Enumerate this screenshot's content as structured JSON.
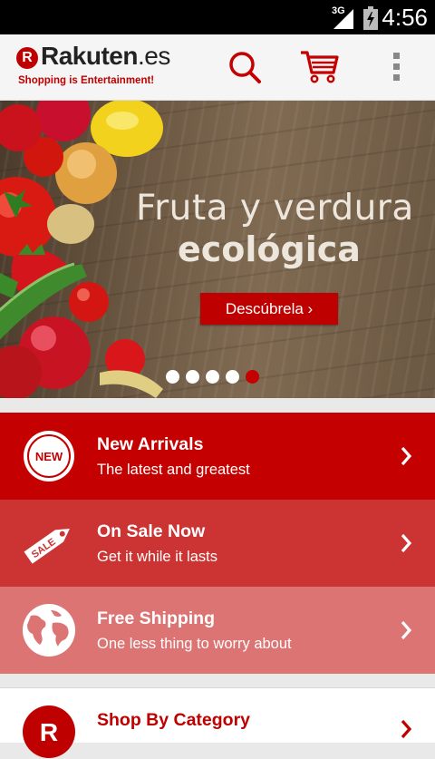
{
  "status_bar": {
    "network": "3G",
    "time": "4:56"
  },
  "app_bar": {
    "logo_mark": "R",
    "brand_name": "Rakuten",
    "brand_tld": ".es",
    "tagline": "Shopping is Entertainment!",
    "icons": [
      "search-icon",
      "cart-icon",
      "overflow-menu-icon"
    ]
  },
  "banner": {
    "title_line1": "Fruta y verdura",
    "title_line2": "ecológica",
    "cta_label": "Descúbrela ›",
    "page_count": 5,
    "active_page": 5
  },
  "promos": [
    {
      "title": "New Arrivals",
      "subtitle": "The latest and greatest",
      "badge": "NEW",
      "icon": "new-badge-icon",
      "color": "#c40000"
    },
    {
      "title": "On Sale Now",
      "subtitle": "Get it while it lasts",
      "badge": "SALE",
      "icon": "sale-tag-icon",
      "color": "#cc3333"
    },
    {
      "title": "Free Shipping",
      "subtitle": "One less thing to worry about",
      "icon": "globe-icon",
      "color": "#dd7474"
    }
  ],
  "category_card": {
    "title": "Shop By Category",
    "logo_mark": "R"
  },
  "colors": {
    "brand_red": "#bf0000",
    "background": "#e9e9e9"
  }
}
